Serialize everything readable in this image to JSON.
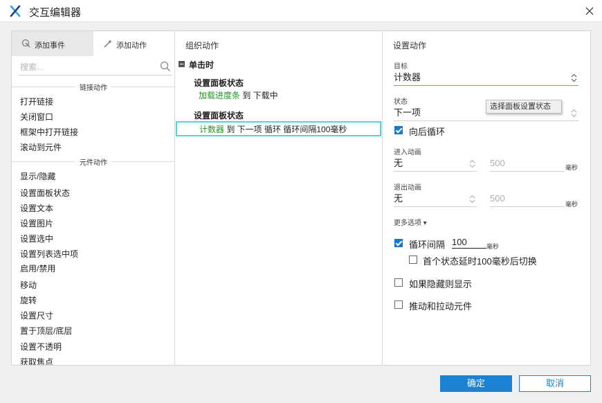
{
  "window": {
    "title": "交互编辑器"
  },
  "left": {
    "tab_events": "添加事件",
    "tab_actions": "添加动作",
    "search_placeholder": "搜索...",
    "section_link": "链接动作",
    "link_items": [
      "打开链接",
      "关闭窗口",
      "框架中打开链接",
      "滚动到元件"
    ],
    "section_widget": "元件动作",
    "widget_items": [
      "显示/隐藏",
      "设置面板状态",
      "设置文本",
      "设置图片",
      "设置选中",
      "设置列表选中项",
      "启用/禁用",
      "移动",
      "旋转",
      "设置尺寸",
      "置于顶层/底层",
      "设置不透明",
      "获取焦点"
    ]
  },
  "middle": {
    "heading": "组织动作",
    "trigger": "单击时",
    "actions": [
      {
        "title": "设置面板状态",
        "target": "加载进度条",
        "detail": " 到 下载中"
      },
      {
        "title": "设置面板状态",
        "target": "计数器",
        "detail": " 到 下一项 循环 循环间隔100毫秒"
      }
    ]
  },
  "right": {
    "heading": "设置动作",
    "target_label": "目标",
    "target_value": "计数器",
    "state_label": "状态",
    "state_value": "下一项",
    "tooltip": "选择面板设置状态",
    "wrap_label": "向后循环",
    "enter_anim_label": "进入动画",
    "enter_anim_value": "无",
    "enter_anim_ms": "500",
    "exit_anim_label": "退出动画",
    "exit_anim_value": "无",
    "exit_anim_ms": "500",
    "unit_ms": "毫秒",
    "more_options": "更多选项 ▾",
    "repeat_label": "循环间隔",
    "repeat_value": "100",
    "first_delay_label": "首个状态延时100毫秒后切换",
    "show_if_hidden_label": "如果隐藏则显示",
    "push_pull_label": "推动和拉动元件"
  },
  "footer": {
    "ok": "确定",
    "cancel": "取消"
  },
  "colors": {
    "accent": "#1a83d6",
    "green": "#1f9a1f",
    "selection": "#4fd4d8"
  }
}
